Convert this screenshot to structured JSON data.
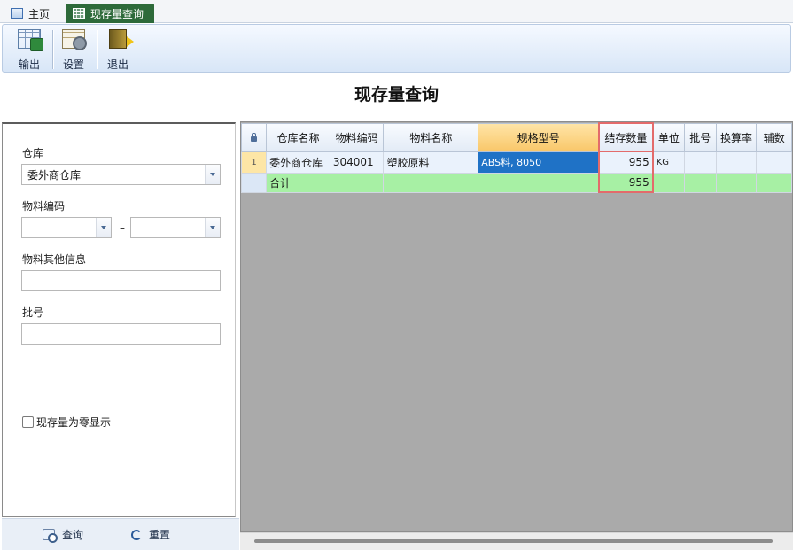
{
  "tabs": [
    {
      "label": "主页",
      "icon": "home-icon"
    },
    {
      "label": "现存量查询",
      "icon": "grid-icon"
    }
  ],
  "toolbar": {
    "export_label": "输出",
    "settings_label": "设置",
    "exit_label": "退出"
  },
  "page": {
    "title": "现存量查询"
  },
  "filter": {
    "warehouse_label": "仓库",
    "warehouse_value": "委外商仓库",
    "material_code_label": "物料编码",
    "material_code_from": "",
    "material_code_to": "",
    "range_separator": "–",
    "material_other_label": "物料其他信息",
    "material_other_value": "",
    "batch_label": "批号",
    "batch_value": "",
    "zero_stock_label": "现存量为零显示",
    "zero_stock_checked": false,
    "query_label": "查询",
    "reset_label": "重置"
  },
  "grid": {
    "columns": [
      "仓库名称",
      "物料编码",
      "物料名称",
      "规格型号",
      "结存数量",
      "单位",
      "批号",
      "换算率",
      "辅数"
    ],
    "rows": [
      {
        "row_no": "1",
        "cells": [
          "委外商仓库",
          "304001",
          "塑胶原料",
          "ABS料, 8050",
          "955",
          "KG",
          "",
          "",
          ""
        ]
      }
    ],
    "total": {
      "label": "合计",
      "quantity": "955"
    }
  },
  "colors": {
    "active_tab": "#2d6a3a",
    "total_row": "#a7f0a4",
    "selected_cell": "#1f72c6",
    "highlight_border": "#e36b6b"
  }
}
